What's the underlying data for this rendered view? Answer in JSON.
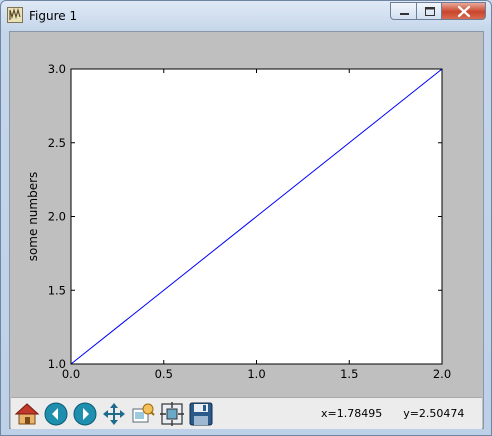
{
  "window": {
    "title": "Figure 1"
  },
  "toolbar": {
    "buttons": [
      "home-icon",
      "back-arrow-icon",
      "forward-arrow-icon",
      "pan-icon",
      "zoom-rectangle-icon",
      "configure-subplots-icon",
      "save-icon"
    ],
    "coord_x": "x=1.78495",
    "coord_y": "y=2.50474"
  },
  "colors": {
    "line": "#0000ff",
    "figure_bg": "#bfbfbf",
    "axes_bg": "#ffffff"
  },
  "chart_data": {
    "type": "line",
    "x": [
      0.0,
      1.0,
      2.0
    ],
    "series": [
      {
        "values": [
          1.0,
          2.0,
          3.0
        ]
      }
    ],
    "xlabel": "",
    "ylabel": "some numbers",
    "xlim": [
      0.0,
      2.0
    ],
    "ylim": [
      1.0,
      3.0
    ],
    "xticks": [
      "0.0",
      "0.5",
      "1.0",
      "1.5",
      "2.0"
    ],
    "yticks": [
      "1.0",
      "1.5",
      "2.0",
      "2.5",
      "3.0"
    ],
    "grid": false
  }
}
